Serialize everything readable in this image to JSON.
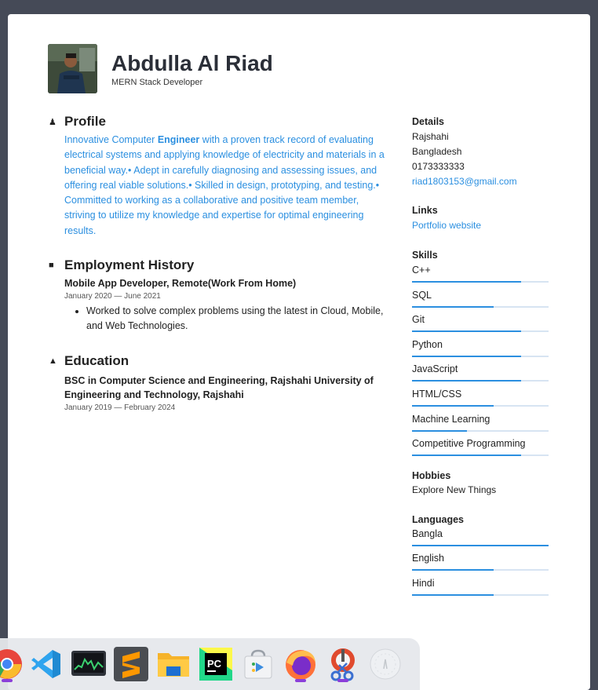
{
  "header": {
    "name": "Abdulla Al Riad",
    "role": "MERN Stack Developer"
  },
  "profile": {
    "title": "Profile",
    "text_pre": "Innovative Computer ",
    "text_bold": "Engineer",
    "text_post": " with a proven track record of evaluating electrical systems and applying knowledge of electricity and materials in a beneficial way.• Adept in carefully diagnosing and assessing issues, and offering real viable solutions.• Skilled in design, prototyping, and testing.• Committed to working as a collaborative and positive team member, striving to utilize my knowledge and expertise for optimal engineering results."
  },
  "employment": {
    "title": "Employment History",
    "job_title": "Mobile App Developer, Remote(Work From Home)",
    "dates": "January 2020 — June 2021",
    "bullet": "Worked to solve complex problems using the latest in Cloud, Mobile, and Web Technologies."
  },
  "education": {
    "title": "Education",
    "degree": "BSC in Computer Science and Engineering, Rajshahi University of Engineering and Technology, Rajshahi",
    "dates": "January 2019 — February 2024"
  },
  "details": {
    "title": "Details",
    "city": "Rajshahi",
    "country": "Bangladesh",
    "phone": "0173333333",
    "email": "riad1803153@gmail.com"
  },
  "links": {
    "title": "Links",
    "portfolio": "Portfolio website"
  },
  "skills": {
    "title": "Skills",
    "items": [
      {
        "label": "C++",
        "level": 0.8
      },
      {
        "label": "SQL",
        "level": 0.6
      },
      {
        "label": "Git",
        "level": 0.8
      },
      {
        "label": "Python",
        "level": 0.8
      },
      {
        "label": "JavaScript",
        "level": 0.8
      },
      {
        "label": "HTML/CSS",
        "level": 0.6
      },
      {
        "label": "Machine Learning",
        "level": 0.4
      },
      {
        "label": "Competitive Programming",
        "level": 0.8
      }
    ]
  },
  "hobbies": {
    "title": "Hobbies",
    "text": "Explore New Things"
  },
  "languages": {
    "title": "Languages",
    "items": [
      {
        "label": "Bangla",
        "level": 1.0
      },
      {
        "label": "English",
        "level": 0.6
      },
      {
        "label": "Hindi",
        "level": 0.6
      }
    ]
  },
  "dock": {
    "apps": [
      "chrome-icon",
      "vscode-icon",
      "system-monitor-icon",
      "sublime-text-icon",
      "files-icon",
      "pycharm-icon",
      "software-store-icon",
      "firefox-icon",
      "screenshot-tool-icon",
      "launcher-icon"
    ],
    "colors": {
      "accent": "#2b8fe0",
      "indicator": "#8b3fd9"
    }
  }
}
